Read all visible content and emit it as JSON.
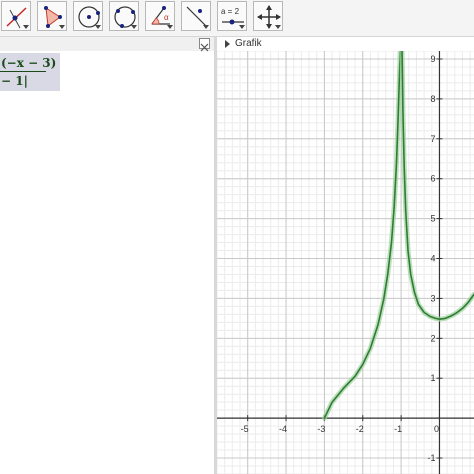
{
  "toolbar": {
    "tools": [
      {
        "icon": "move-icon"
      },
      {
        "icon": "polygon-icon"
      },
      {
        "icon": "circle-center-icon"
      },
      {
        "icon": "circle-three-points-icon"
      },
      {
        "icon": "angle-icon"
      },
      {
        "icon": "reflect-line-icon"
      },
      {
        "icon": "slider-icon",
        "label": "a = 2"
      },
      {
        "icon": "move-graphics-view-icon"
      }
    ]
  },
  "algebra": {
    "formula_numerator": "(−x − 3)",
    "formula_denominator": "− 1|"
  },
  "graphics": {
    "title": "Grafik",
    "curve_color": "#2e7d32"
  },
  "chart_data": {
    "type": "line",
    "title": "",
    "xlim": [
      -5.8,
      0.9
    ],
    "ylim": [
      -1.4,
      9.2
    ],
    "x_ticks": [
      -5,
      -4,
      -3,
      -2,
      -1,
      0
    ],
    "y_ticks": [
      -1,
      1,
      2,
      3,
      4,
      5,
      6,
      7,
      8,
      9
    ],
    "x_tick_labels": [
      "-5",
      "-4",
      "-3",
      "-2",
      "-1",
      "0"
    ],
    "y_tick_labels": [
      "-1",
      "1",
      "2",
      "3",
      "4",
      "5",
      "6",
      "7",
      "8",
      "9"
    ],
    "grid": true,
    "series": [
      {
        "x": [
          -3.0,
          -2.8,
          -2.5,
          -2.2,
          -2.0,
          -1.8,
          -1.6,
          -1.45,
          -1.35,
          -1.25,
          -1.18,
          -1.12,
          -1.08,
          -1.05,
          -1.03,
          -1.02
        ],
        "y": [
          0.0,
          0.4,
          0.75,
          1.05,
          1.35,
          1.75,
          2.35,
          3.0,
          3.6,
          4.4,
          5.3,
          6.4,
          7.5,
          8.4,
          9.0,
          9.4
        ]
      },
      {
        "x": [
          -0.98,
          -0.97,
          -0.95,
          -0.92,
          -0.88,
          -0.82,
          -0.75,
          -0.65,
          -0.55,
          -0.4,
          -0.25,
          -0.1,
          0.0,
          0.15,
          0.3,
          0.45,
          0.6,
          0.75,
          0.9
        ],
        "y": [
          9.4,
          8.8,
          7.6,
          6.3,
          5.2,
          4.2,
          3.6,
          3.15,
          2.85,
          2.65,
          2.55,
          2.5,
          2.48,
          2.5,
          2.56,
          2.64,
          2.75,
          2.9,
          3.1
        ]
      }
    ]
  }
}
